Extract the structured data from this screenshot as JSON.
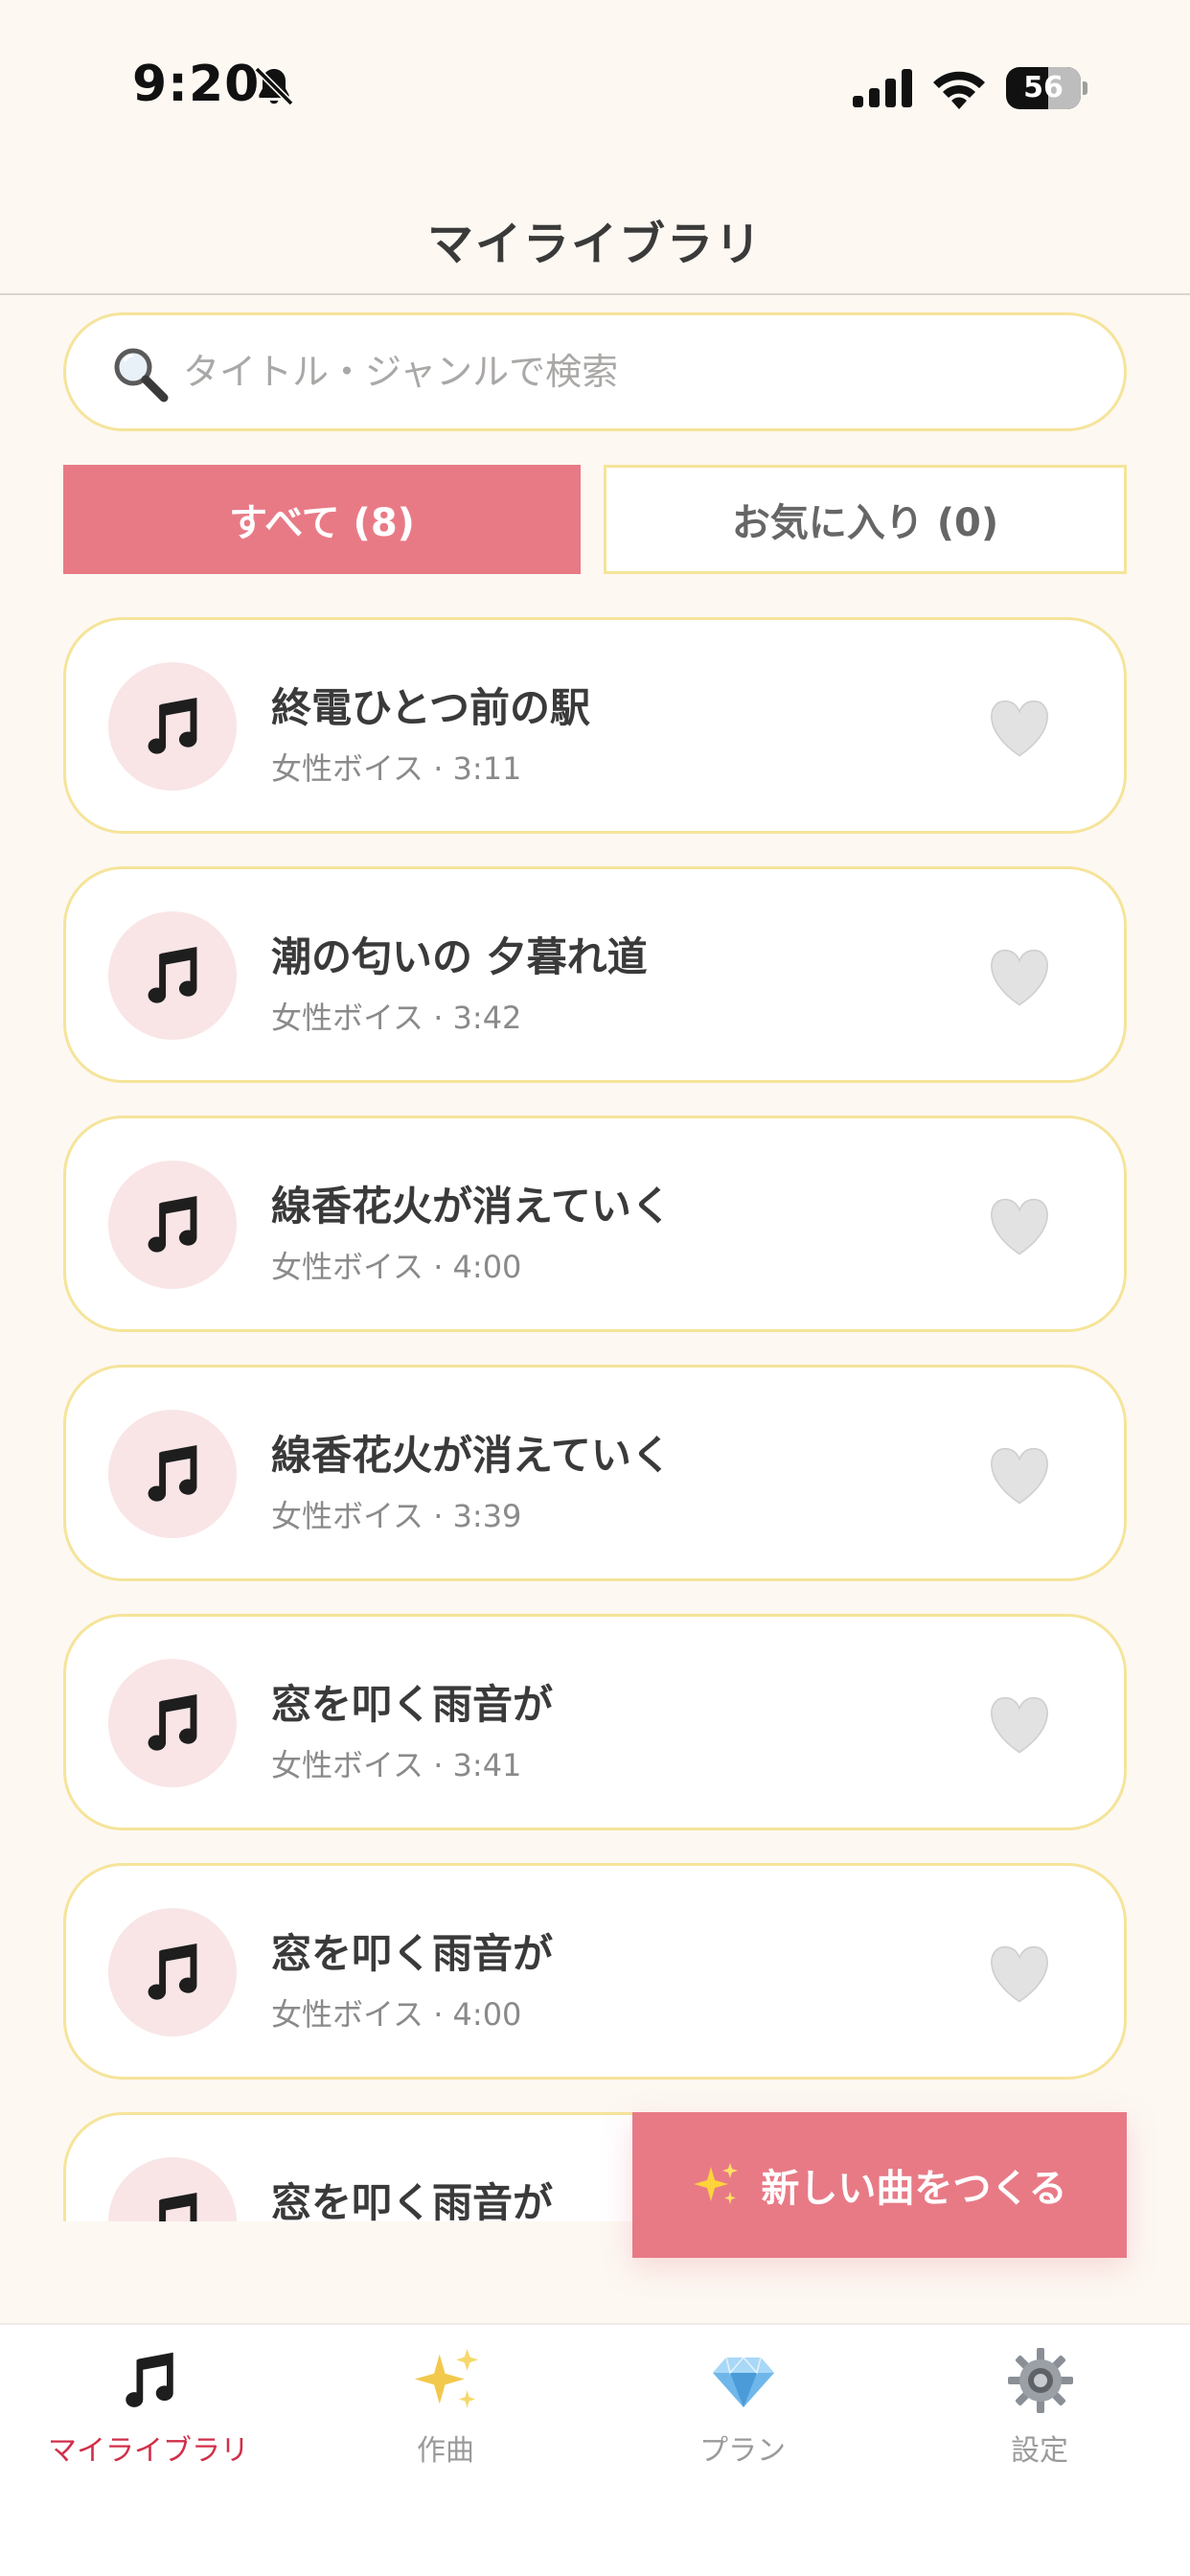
{
  "status_bar": {
    "time": "9:20",
    "battery_level": "56",
    "battery_fraction": 0.56
  },
  "header": {
    "title": "マイライブラリ"
  },
  "search": {
    "placeholder": "タイトル・ジャンルで検索",
    "value": ""
  },
  "filter_tabs": [
    {
      "label": "すべて (8)",
      "selected": true
    },
    {
      "label": "お気に入り (0)",
      "selected": false
    }
  ],
  "songs": [
    {
      "title": "終電ひとつ前の駅",
      "meta": "女性ボイス · 3:11",
      "favorite": false
    },
    {
      "title": "潮の匂いの 夕暮れ道",
      "meta": "女性ボイス · 3:42",
      "favorite": false
    },
    {
      "title": "線香花火が消えていく",
      "meta": "女性ボイス · 4:00",
      "favorite": false
    },
    {
      "title": "線香花火が消えていく",
      "meta": "女性ボイス · 3:39",
      "favorite": false
    },
    {
      "title": "窓を叩く雨音が",
      "meta": "女性ボイス · 3:41",
      "favorite": false
    },
    {
      "title": "窓を叩く雨音が",
      "meta": "女性ボイス · 4:00",
      "favorite": false
    },
    {
      "title": "窓を叩く雨音が",
      "meta": "",
      "favorite": false
    }
  ],
  "fab": {
    "label": "新しい曲をつくる",
    "icon": "sparkles-icon"
  },
  "tab_bar": [
    {
      "label": "マイライブラリ",
      "icon": "music-note-icon",
      "active": true
    },
    {
      "label": "作曲",
      "icon": "sparkles-icon",
      "active": false
    },
    {
      "label": "プラン",
      "icon": "diamond-icon",
      "active": false
    },
    {
      "label": "設定",
      "icon": "gear-icon",
      "active": false
    }
  ],
  "colors": {
    "background": "#fdf8f2",
    "accent": "#e87a86",
    "card_border": "#f5e49a",
    "art_background": "#f9e5e6",
    "active_tab_text": "#d12f4a"
  }
}
